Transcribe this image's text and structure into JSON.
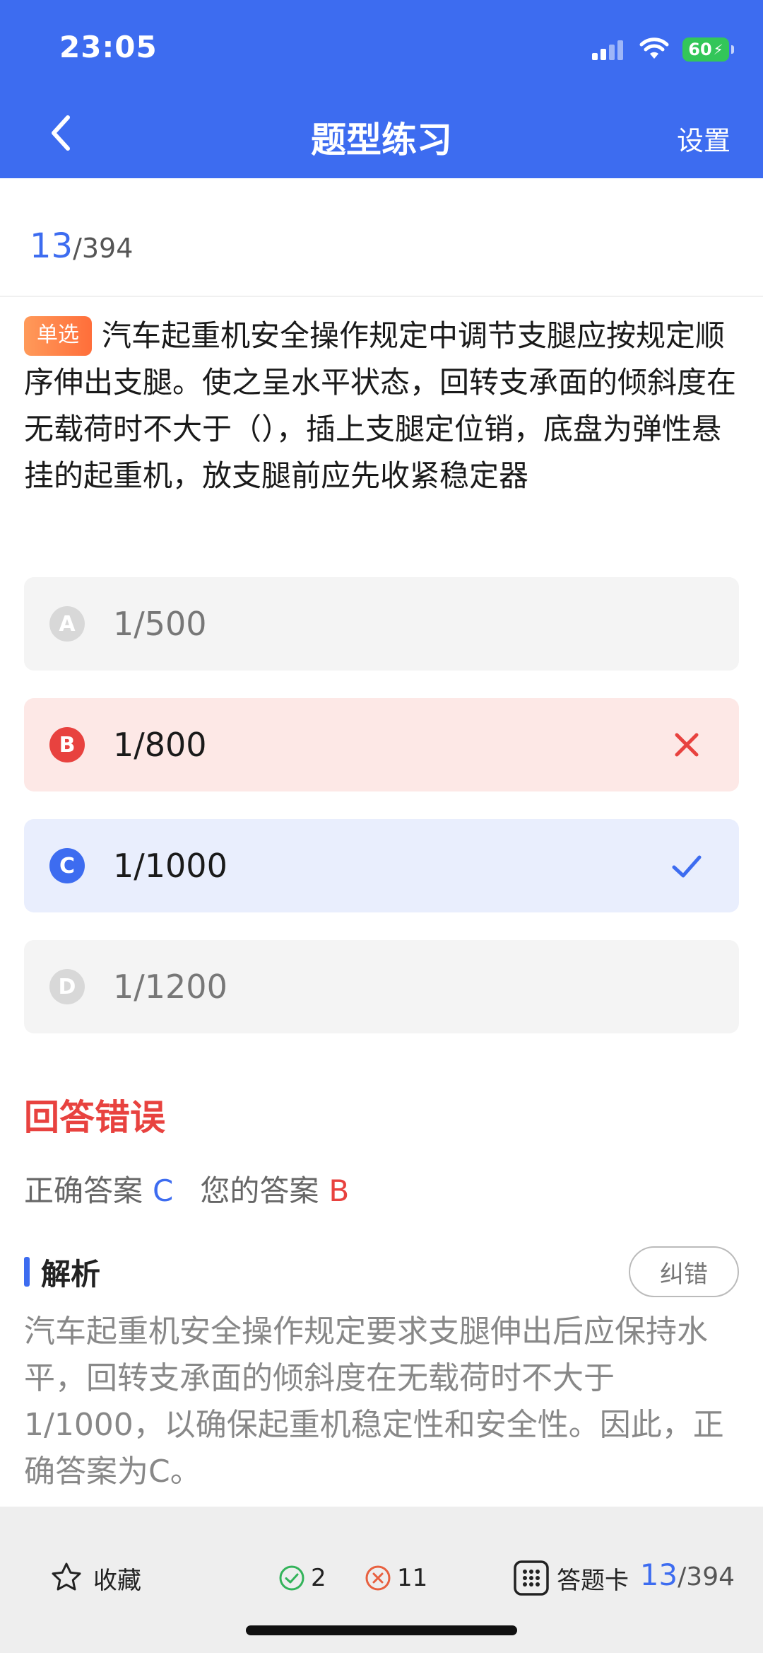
{
  "status_bar": {
    "time": "23:05",
    "battery": "60"
  },
  "nav": {
    "title": "题型练习",
    "settings": "设置"
  },
  "progress": {
    "current": "13",
    "total": "/394"
  },
  "question": {
    "type_badge": "单选",
    "text": "汽车起重机安全操作规定中调节支腿应按规定顺序伸出支腿。使之呈水平状态，回转支承面的倾斜度在无载荷时不大于（），插上支腿定位销，底盘为弹性悬挂的起重机，放支腿前应先收紧稳定器"
  },
  "options": [
    {
      "letter": "A",
      "text": "1/500",
      "state": "neutral"
    },
    {
      "letter": "B",
      "text": "1/800",
      "state": "wrong"
    },
    {
      "letter": "C",
      "text": "1/1000",
      "state": "correct"
    },
    {
      "letter": "D",
      "text": "1/1200",
      "state": "neutral"
    }
  ],
  "result": {
    "title": "回答错误",
    "correct_label": "正确答案",
    "correct_value": "C",
    "user_label": "您的答案",
    "user_value": "B"
  },
  "analysis": {
    "title": "解析",
    "report_button": "纠错",
    "text": "汽车起重机安全操作规定要求支腿伸出后应保持水平，回转支承面的倾斜度在无载荷时不大于1/1000，以确保起重机稳定性和安全性。因此，正确答案为C。"
  },
  "bottom_bar": {
    "favorite_label": "收藏",
    "correct_count": "2",
    "wrong_count": "11",
    "answer_card_label": "答题卡",
    "progress_current": "13",
    "progress_total": "/394"
  },
  "colors": {
    "primary": "#3d6cf0",
    "error": "#e8423f",
    "success": "#33b35a",
    "badge": "#ff7a45"
  },
  "icons": [
    "back-arrow-icon",
    "signal-icon",
    "wifi-icon",
    "battery-icon",
    "wrong-x-icon",
    "check-icon",
    "star-icon",
    "check-circle-icon",
    "x-circle-icon",
    "grid-icon"
  ]
}
